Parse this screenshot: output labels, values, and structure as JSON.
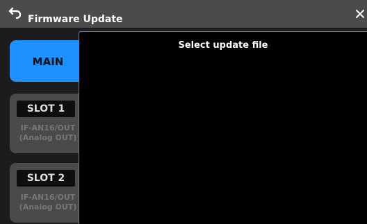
{
  "window": {
    "title": "Firmware Update"
  },
  "tabs": {
    "main": {
      "label": "MAIN"
    },
    "slot1": {
      "label": "SLOT 1",
      "line1": "IF-AN16/OUT",
      "line2": "(Analog OUT)"
    },
    "slot2": {
      "label": "SLOT 2",
      "line1": "IF-AN16/OUT",
      "line2": "(Analog OUT)"
    }
  },
  "panel": {
    "title": "Select update file"
  },
  "icons": {
    "back": "back-arrow-icon",
    "close": "close-icon"
  },
  "colors": {
    "accent": "#1e90ff",
    "titlebar": "#4b4b4b",
    "panel_bg": "#000000"
  }
}
